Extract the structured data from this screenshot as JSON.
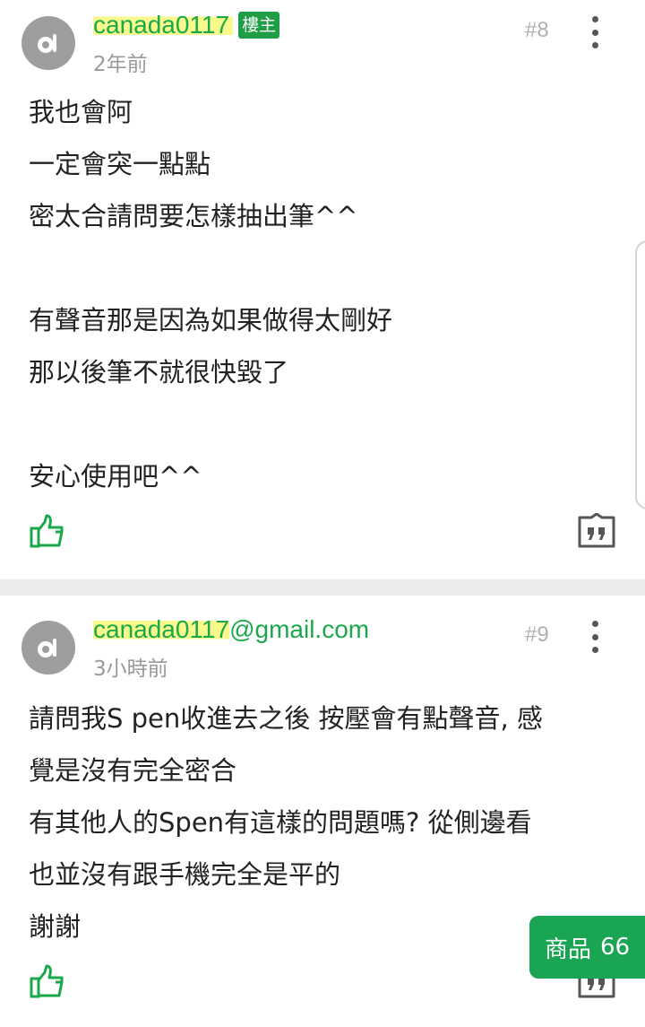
{
  "posts": [
    {
      "username": "canada0117",
      "badge": "樓主",
      "time": "2年前",
      "floor": "#8",
      "lines": [
        "我也會阿",
        "一定會突一點點",
        "密太合請問要怎樣抽出筆^^",
        "",
        "有聲音那是因為如果做得太剛好",
        "那以後筆不就很快毀了",
        "",
        "安心使用吧^^"
      ]
    },
    {
      "username": "canada0117",
      "username_suffix": "@gmail.com",
      "time": "3小時前",
      "floor": "#9",
      "lines": [
        "請問我S pen收進去之後 按壓會有點聲音, 感",
        "覺是沒有完全密合",
        "有其他人的Spen有這樣的問題嗎? 從側邊看",
        "也並沒有跟手機完全是平的",
        "謝謝"
      ]
    }
  ],
  "product_button": {
    "label": "商品",
    "count": "66"
  },
  "colors": {
    "accent": "#1aa84a",
    "badge": "#1f9e46",
    "highlight": "#f8f878",
    "divider": "#ebebeb"
  },
  "icons": {
    "like": "thumbs-up-icon",
    "quote": "quote-icon",
    "more": "more-vertical-icon",
    "avatar": "default-avatar-icon"
  }
}
